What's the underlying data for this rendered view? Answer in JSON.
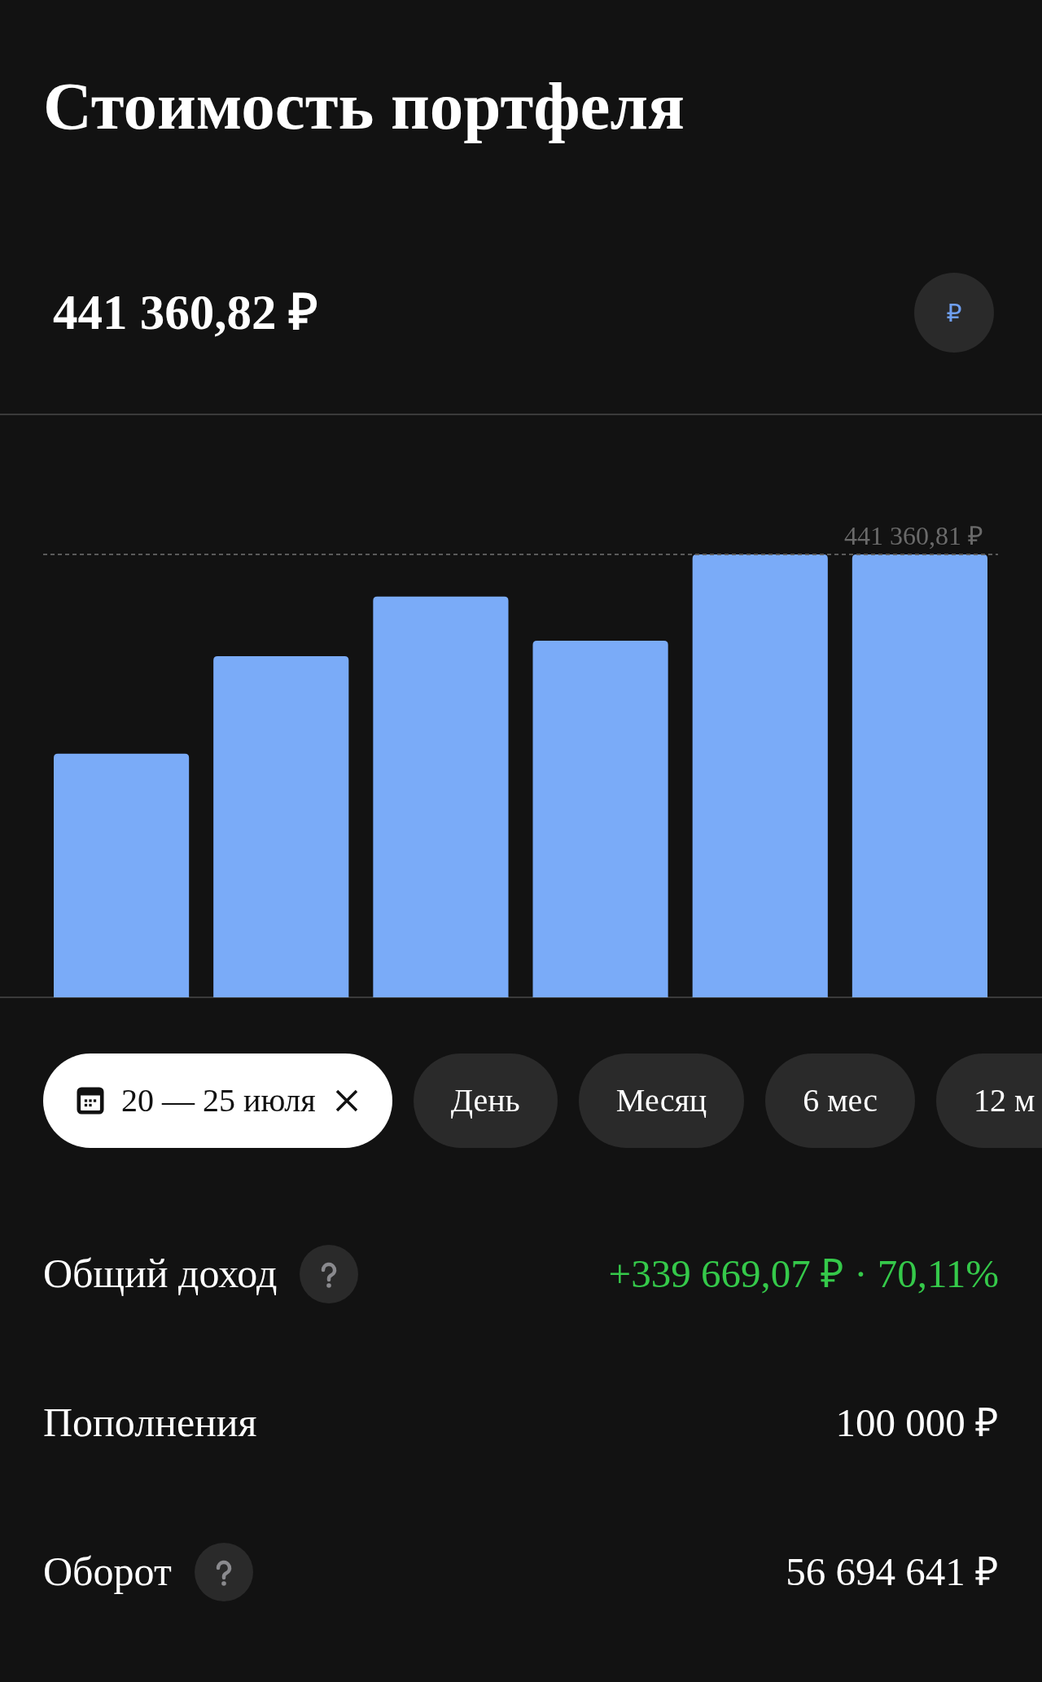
{
  "title": "Стоимость портфеля",
  "portfolio": {
    "value": "441 360,82 ₽",
    "currency_button": "₽"
  },
  "chart": {
    "max_label": "441 360,81 ₽"
  },
  "periods": [
    {
      "kind": "range",
      "label": "20 — 25 июля",
      "selected": true
    },
    {
      "kind": "period",
      "label": "День",
      "selected": false
    },
    {
      "kind": "period",
      "label": "Месяц",
      "selected": false
    },
    {
      "kind": "period",
      "label": "6 мес",
      "selected": false
    },
    {
      "kind": "period",
      "label": "12 м",
      "selected": false
    }
  ],
  "stats": [
    {
      "label": "Общий доход",
      "help": true,
      "value": "+339 669,07 ₽ · 70,11%",
      "positive": true
    },
    {
      "label": "Пополнения",
      "help": false,
      "value": "100 000 ₽",
      "positive": false
    },
    {
      "label": "Оборот",
      "help": true,
      "value": "56 694 641 ₽",
      "positive": false
    }
  ]
}
